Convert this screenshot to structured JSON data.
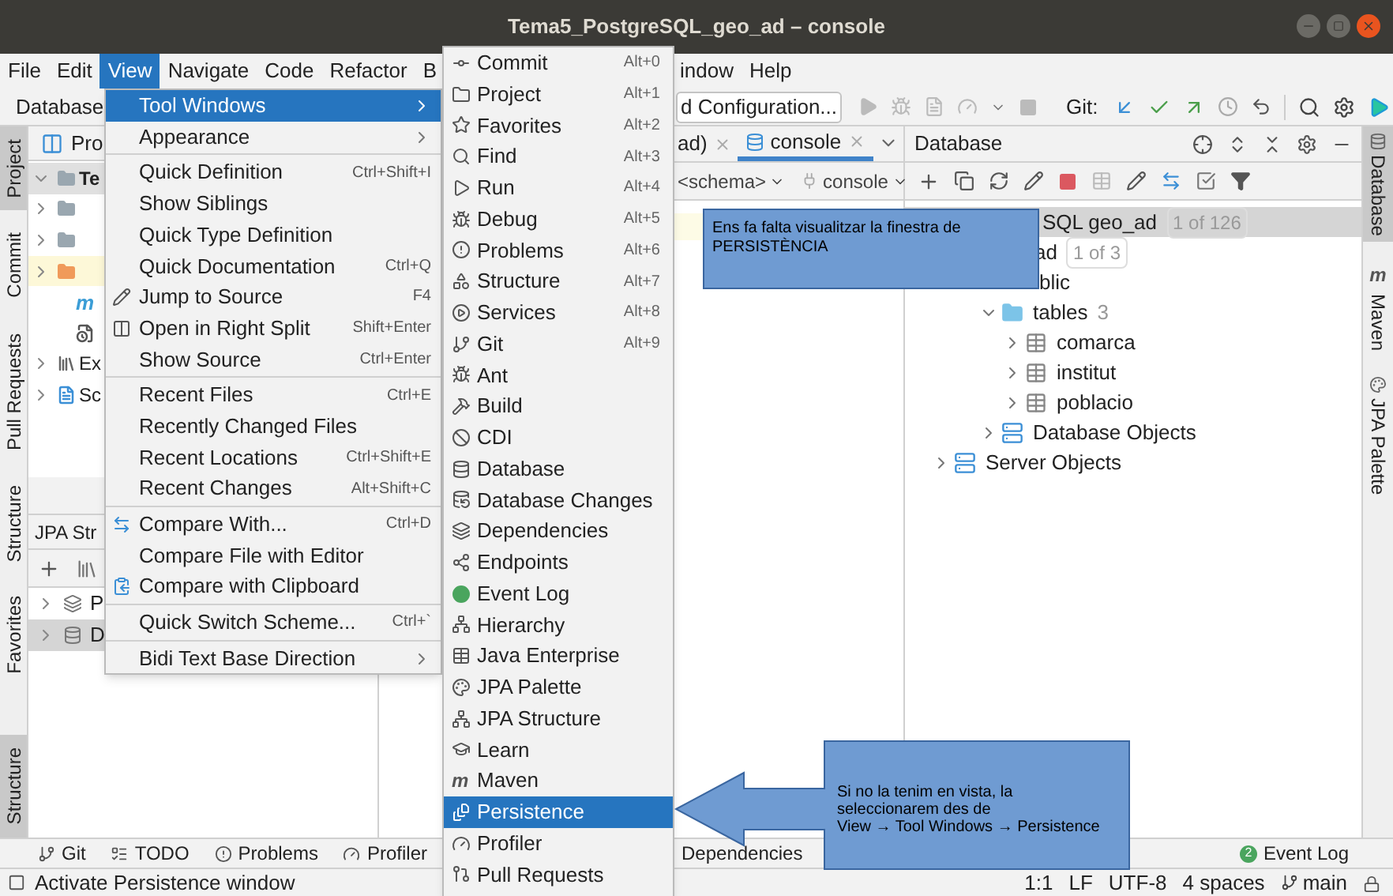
{
  "window": {
    "title": "Tema5_PostgreSQL_geo_ad – console"
  },
  "menubar": [
    {
      "label": "File",
      "selected": false
    },
    {
      "label": "Edit",
      "selected": false
    },
    {
      "label": "View",
      "selected": true
    },
    {
      "label": "Navigate",
      "selected": false
    },
    {
      "label": "Code",
      "selected": false
    },
    {
      "label": "Refactor",
      "selected": false
    },
    {
      "label": "B",
      "selected": false
    },
    {
      "label": "indow",
      "selected": false
    },
    {
      "label": "Help",
      "selected": false
    }
  ],
  "toolbar": {
    "label": "Database",
    "run_config": "d Configuration...",
    "git_label": "Git:"
  },
  "left_stripe": [
    {
      "label": "Project",
      "selected": true
    },
    {
      "label": "Commit",
      "selected": false
    },
    {
      "label": "Pull Requests",
      "selected": false
    },
    {
      "label": "Structure",
      "selected": false
    },
    {
      "label": "Favorites",
      "selected": false
    },
    {
      "label": "Structure",
      "selected": true
    }
  ],
  "project_panel": {
    "title": "Pro",
    "rows": [
      {
        "kind": "module",
        "label": "Te",
        "expanded": true,
        "highlighted": false
      },
      {
        "kind": "folder",
        "expanded": false,
        "highlighted": false
      },
      {
        "kind": "folder",
        "expanded": false,
        "highlighted": false
      },
      {
        "kind": "orange-folder",
        "expanded": false,
        "highlighted": true
      },
      {
        "kind": "maven",
        "icon_char": "m",
        "highlighted": false
      },
      {
        "kind": "file",
        "highlighted": false
      },
      {
        "kind": "libraries",
        "label": "Ex",
        "expanded": false,
        "highlighted": false
      },
      {
        "kind": "scratches",
        "label": "Sc",
        "expanded": false,
        "highlighted": false
      }
    ]
  },
  "jpa_panel": {
    "title": "JPA Str",
    "rows": [
      {
        "label": "P",
        "selected": false
      },
      {
        "label": "D",
        "selected": true
      }
    ]
  },
  "editor": {
    "tabs": [
      {
        "label": "ad)",
        "selected": false
      },
      {
        "label": "console",
        "selected": true
      }
    ],
    "schema": "<schema>",
    "session": "console"
  },
  "database_panel": {
    "title": "Database",
    "tree": [
      {
        "label": "SQL geo_ad",
        "count": "1 of 126",
        "selected": true,
        "children": [
          {
            "label": "ad",
            "count": "1 of 3",
            "selected": false,
            "children": [
              {
                "label": "blic",
                "selected": false,
                "children": [
                  {
                    "label": "tables",
                    "count": "3",
                    "kind": "folder",
                    "expanded": true,
                    "selected": false,
                    "children": [
                      {
                        "label": "comarca",
                        "kind": "table",
                        "expanded": false,
                        "selected": false
                      },
                      {
                        "label": "institut",
                        "kind": "table",
                        "expanded": false,
                        "selected": false
                      },
                      {
                        "label": "poblacio",
                        "kind": "table",
                        "expanded": false,
                        "selected": false
                      }
                    ]
                  },
                  {
                    "label": "Database Objects",
                    "kind": "objects",
                    "expanded": false,
                    "selected": false
                  }
                ]
              }
            ]
          },
          {
            "label": "Server Objects",
            "kind": "objects",
            "expanded": false,
            "selected": false
          }
        ]
      }
    ]
  },
  "right_stripe": [
    {
      "label": "Database",
      "selected": true
    },
    {
      "label": "Maven",
      "icon_char": "m",
      "selected": false
    },
    {
      "label": "JPA Palette",
      "selected": false
    }
  ],
  "view_menu": [
    {
      "kind": "item",
      "label": "Tool Windows",
      "submenu": true,
      "selected": true
    },
    {
      "kind": "item",
      "label": "Appearance",
      "submenu": true,
      "selected": false
    },
    {
      "kind": "separator"
    },
    {
      "kind": "item",
      "label": "Quick Definition",
      "shortcut": "Ctrl+Shift+I",
      "selected": false
    },
    {
      "kind": "item",
      "label": "Show Siblings",
      "selected": false
    },
    {
      "kind": "item",
      "label": "Quick Type Definition",
      "selected": false
    },
    {
      "kind": "item",
      "label": "Quick Documentation",
      "shortcut": "Ctrl+Q",
      "selected": false
    },
    {
      "kind": "item",
      "label": "Jump to Source",
      "shortcut": "F4",
      "selected": false
    },
    {
      "kind": "item",
      "label": "Open in Right Split",
      "shortcut": "Shift+Enter",
      "selected": false
    },
    {
      "kind": "item",
      "label": "Show Source",
      "shortcut": "Ctrl+Enter",
      "selected": false
    },
    {
      "kind": "separator"
    },
    {
      "kind": "item",
      "label": "Recent Files",
      "shortcut": "Ctrl+E",
      "selected": false
    },
    {
      "kind": "item",
      "label": "Recently Changed Files",
      "selected": false
    },
    {
      "kind": "item",
      "label": "Recent Locations",
      "shortcut": "Ctrl+Shift+E",
      "selected": false
    },
    {
      "kind": "item",
      "label": "Recent Changes",
      "shortcut": "Alt+Shift+C",
      "selected": false
    },
    {
      "kind": "separator"
    },
    {
      "kind": "item",
      "label": "Compare With...",
      "shortcut": "Ctrl+D",
      "selected": false
    },
    {
      "kind": "item",
      "label": "Compare File with Editor",
      "selected": false
    },
    {
      "kind": "item",
      "label": "Compare with Clipboard",
      "selected": false
    },
    {
      "kind": "separator"
    },
    {
      "kind": "item",
      "label": "Quick Switch Scheme...",
      "shortcut": "Ctrl+`",
      "selected": false
    },
    {
      "kind": "separator"
    },
    {
      "kind": "item",
      "label": "Bidi Text Base Direction",
      "submenu": true,
      "selected": false
    }
  ],
  "tool_windows_menu": [
    {
      "label": "Commit",
      "shortcut": "Alt+0",
      "selected": false
    },
    {
      "label": "Project",
      "shortcut": "Alt+1",
      "selected": false
    },
    {
      "label": "Favorites",
      "shortcut": "Alt+2",
      "selected": false
    },
    {
      "label": "Find",
      "shortcut": "Alt+3",
      "selected": false
    },
    {
      "label": "Run",
      "shortcut": "Alt+4",
      "selected": false
    },
    {
      "label": "Debug",
      "shortcut": "Alt+5",
      "selected": false
    },
    {
      "label": "Problems",
      "shortcut": "Alt+6",
      "selected": false
    },
    {
      "label": "Structure",
      "shortcut": "Alt+7",
      "selected": false
    },
    {
      "label": "Services",
      "shortcut": "Alt+8",
      "selected": false
    },
    {
      "label": "Git",
      "shortcut": "Alt+9",
      "selected": false
    },
    {
      "label": "Ant",
      "selected": false
    },
    {
      "label": "Build",
      "selected": false
    },
    {
      "label": "CDI",
      "selected": false
    },
    {
      "label": "Database",
      "selected": false
    },
    {
      "label": "Database Changes",
      "selected": false
    },
    {
      "label": "Dependencies",
      "selected": false
    },
    {
      "label": "Endpoints",
      "selected": false
    },
    {
      "label": "Event Log",
      "selected": false
    },
    {
      "label": "Hierarchy",
      "selected": false
    },
    {
      "label": "Java Enterprise",
      "selected": false
    },
    {
      "label": "JPA Palette",
      "selected": false
    },
    {
      "label": "JPA Structure",
      "selected": false
    },
    {
      "label": "Learn",
      "selected": false
    },
    {
      "label": "Maven",
      "icon_char": "m",
      "selected": false
    },
    {
      "label": "Persistence",
      "selected": true
    },
    {
      "label": "Profiler",
      "selected": false
    },
    {
      "label": "Pull Requests",
      "selected": false
    }
  ],
  "bottom_tools": [
    {
      "label": "Git"
    },
    {
      "label": "TODO"
    },
    {
      "label": "Problems"
    },
    {
      "label": "Profiler"
    },
    {
      "label": "Dependencies"
    }
  ],
  "event_log": {
    "label": "Event Log",
    "badge": "2"
  },
  "status_bar": {
    "message": "Activate Persistence window",
    "items": [
      "1:1",
      "LF",
      "UTF-8",
      "4 spaces",
      "main"
    ]
  },
  "callouts": [
    {
      "kind": "box",
      "text": "Ens fa falta visualitzar la finestra de PERSISTÈNCIA"
    },
    {
      "kind": "arrow",
      "text": "Si no la tenim en vista, la\nseleccionarem des de\nView → Tool Windows → Persistence"
    }
  ]
}
